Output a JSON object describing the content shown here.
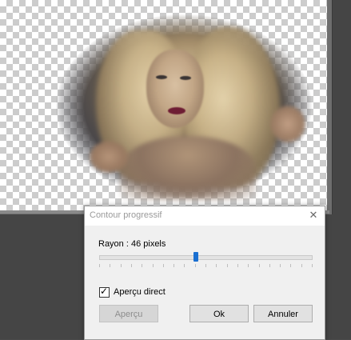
{
  "dialog": {
    "title": "Contour progressif",
    "radius_label": "Rayon : 46 pixels",
    "radius_value": 46,
    "slider_fraction": 0.455,
    "live_preview_label": "Aperçu direct",
    "live_preview_checked": true,
    "preview_button": "Aperçu",
    "ok_button": "Ok",
    "cancel_button": "Annuler",
    "close_icon": "close-icon",
    "check_icon": "checkmark-icon"
  },
  "colors": {
    "slider_thumb": "#1a6fd1",
    "lips": "#6e1d34"
  }
}
